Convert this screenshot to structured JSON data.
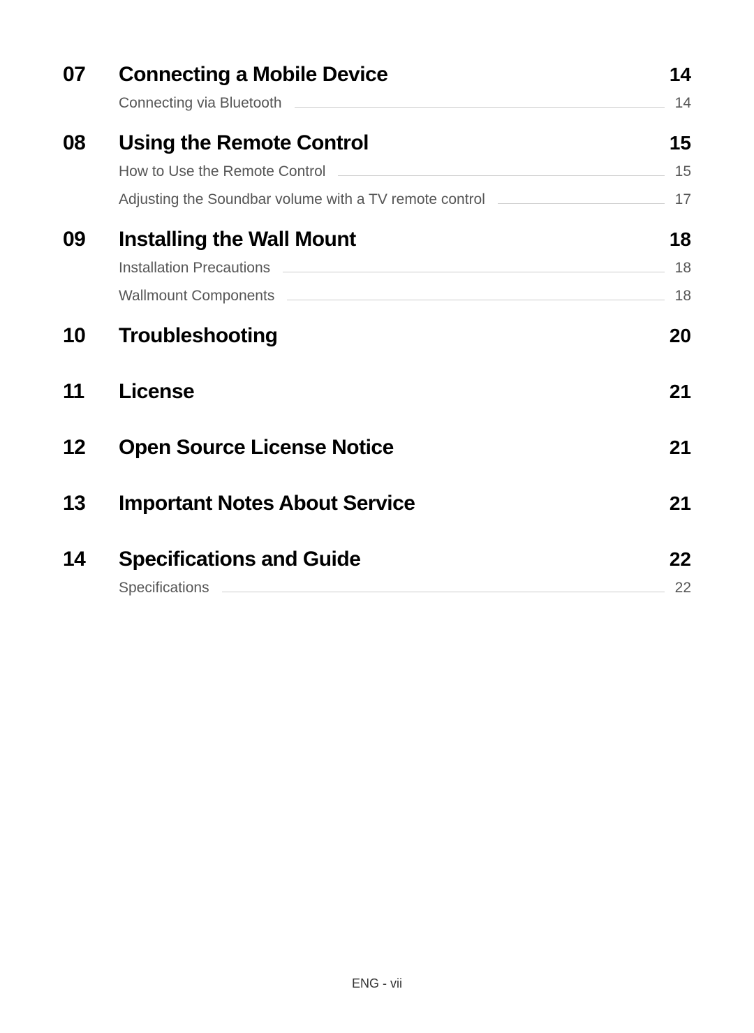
{
  "sections": [
    {
      "number": "07",
      "title": "Connecting a Mobile Device",
      "page": "14",
      "subs": [
        {
          "title": "Connecting via Bluetooth",
          "page": "14"
        }
      ]
    },
    {
      "number": "08",
      "title": "Using the Remote Control",
      "page": "15",
      "subs": [
        {
          "title": "How to Use the Remote Control",
          "page": "15"
        },
        {
          "title": "Adjusting the Soundbar volume with a TV remote control",
          "page": "17"
        }
      ]
    },
    {
      "number": "09",
      "title": "Installing the Wall Mount",
      "page": "18",
      "subs": [
        {
          "title": "Installation Precautions",
          "page": "18"
        },
        {
          "title": "Wallmount Components",
          "page": "18"
        }
      ]
    },
    {
      "number": "10",
      "title": "Troubleshooting",
      "page": "20",
      "subs": []
    },
    {
      "number": "11",
      "title": "License",
      "page": "21",
      "subs": []
    },
    {
      "number": "12",
      "title": "Open Source License Notice",
      "page": "21",
      "subs": []
    },
    {
      "number": "13",
      "title": "Important Notes About Service",
      "page": "21",
      "subs": []
    },
    {
      "number": "14",
      "title": "Specifications and Guide",
      "page": "22",
      "subs": [
        {
          "title": "Specifications",
          "page": "22"
        }
      ]
    }
  ],
  "footer": "ENG - vii"
}
